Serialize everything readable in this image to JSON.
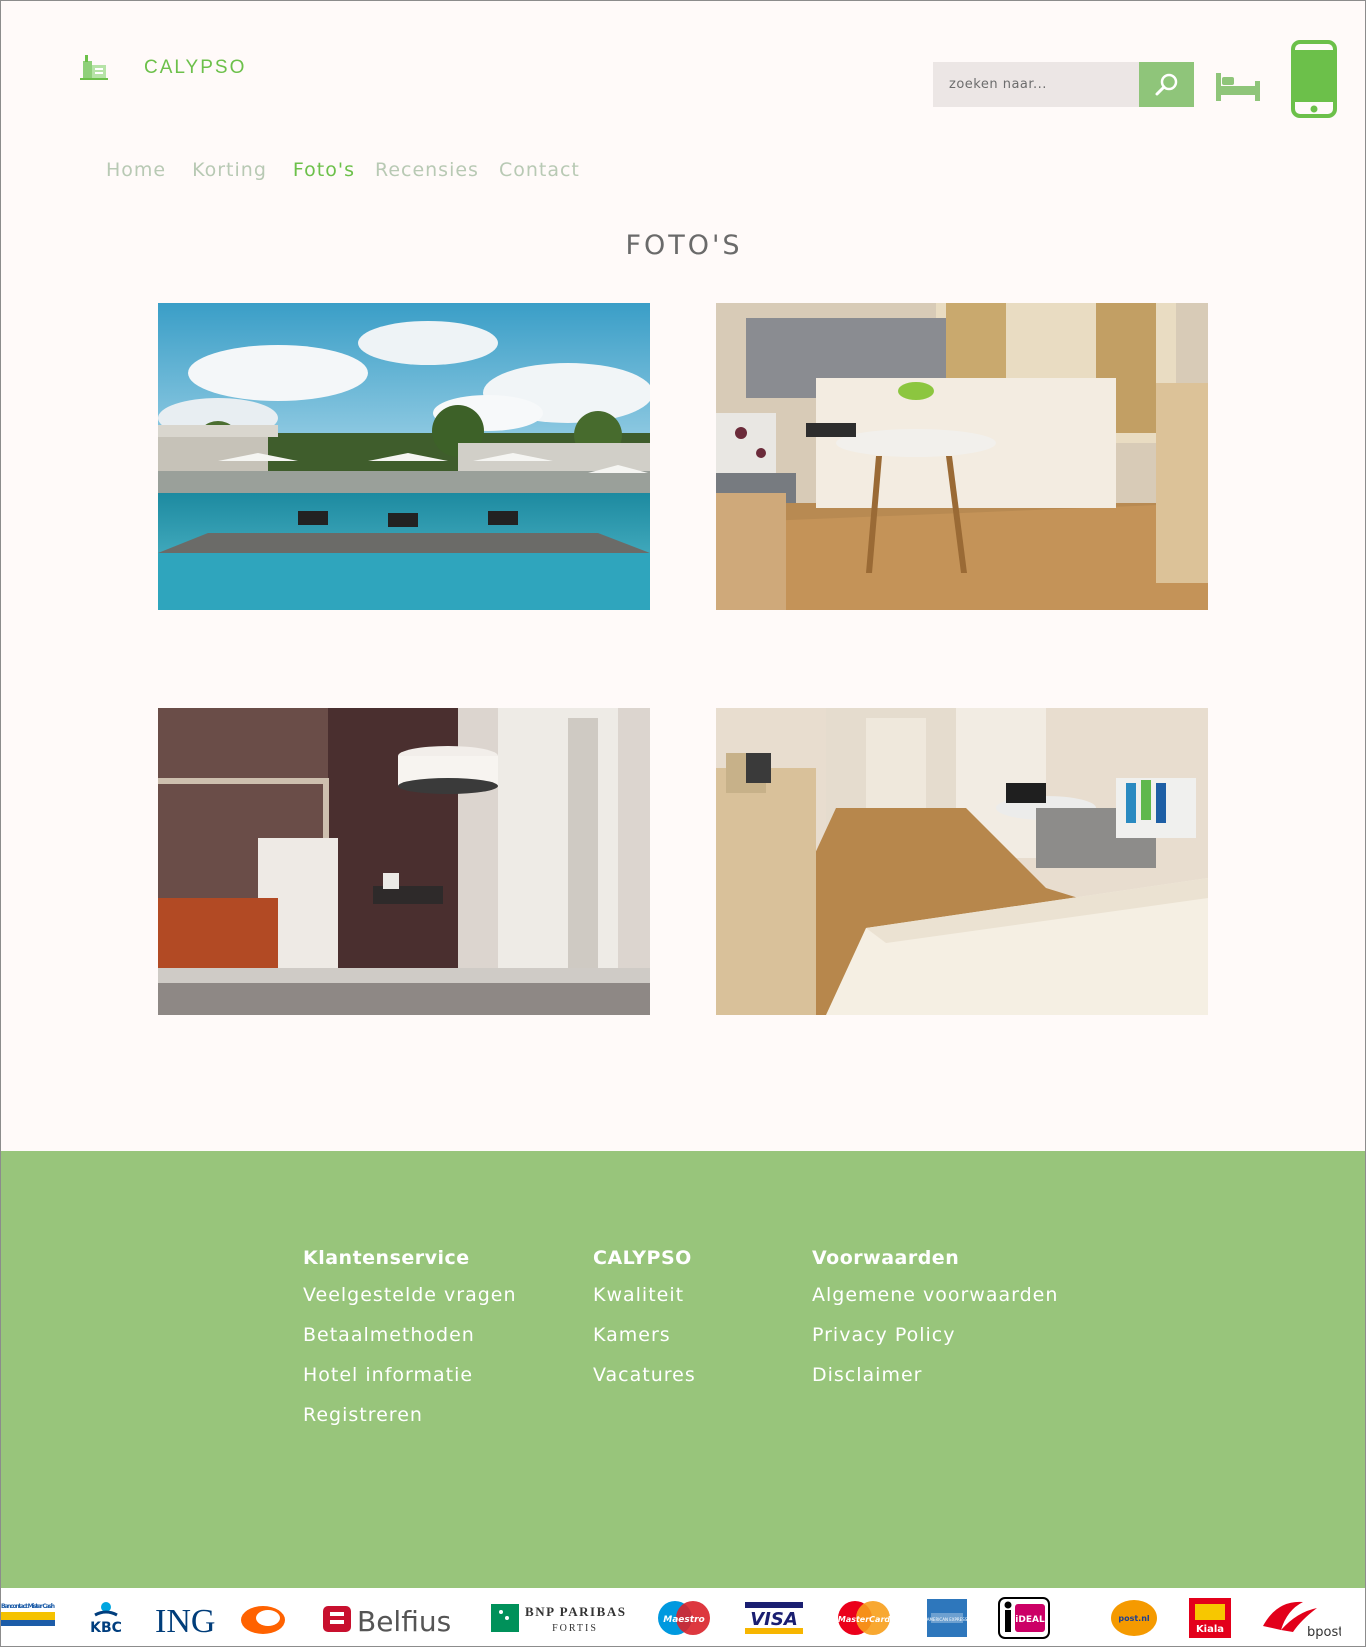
{
  "brand": {
    "name": "CALYPSO",
    "logo_icon": "hotel-building-icon"
  },
  "search": {
    "placeholder": "zoeken naar...",
    "button_icon": "search-icon"
  },
  "header_icons": {
    "bed": "bed-icon",
    "phone": "smartphone-icon"
  },
  "nav": {
    "items": [
      {
        "label": "Home"
      },
      {
        "label": "Korting"
      },
      {
        "label": "Foto's",
        "active": true
      },
      {
        "label": "Recensies"
      },
      {
        "label": "Contact"
      }
    ]
  },
  "page": {
    "title": "FOTO'S"
  },
  "photos": [
    "pool-photo",
    "bedroom-photo",
    "bed-lamp-photo",
    "room-corridor-photo"
  ],
  "footer": {
    "columns": [
      {
        "title": "Klantenservice",
        "links": [
          "Veelgestelde vragen",
          "Betaalmethoden",
          "Hotel informatie",
          "Registreren"
        ]
      },
      {
        "title": "CALYPSO",
        "links": [
          "Kwaliteit",
          "Kamers",
          "Vacatures"
        ]
      },
      {
        "title": "Voorwaarden",
        "links": [
          "Algemene voorwaarden",
          "Privacy Policy",
          "Disclaimer"
        ]
      }
    ]
  },
  "payments": {
    "bancontact": "Bancontact Mister Cash",
    "kbc": "KBC",
    "ing": "ING",
    "belfius": "Belfius",
    "bnp": "BNP PARIBAS",
    "bnp_sub": "FORTIS",
    "maestro": "Maestro",
    "visa": "VISA",
    "mastercard": "MasterCard",
    "amex": "AMERICAN EXPRESS",
    "ideal": "iDEAL",
    "postnl": "post.nl",
    "kiala": "Kiala",
    "bpost": "bpost"
  },
  "colors": {
    "accent": "#6cc04a",
    "footer": "#98c57b",
    "search_button": "#8fc57a",
    "background": "#fffaf9"
  }
}
